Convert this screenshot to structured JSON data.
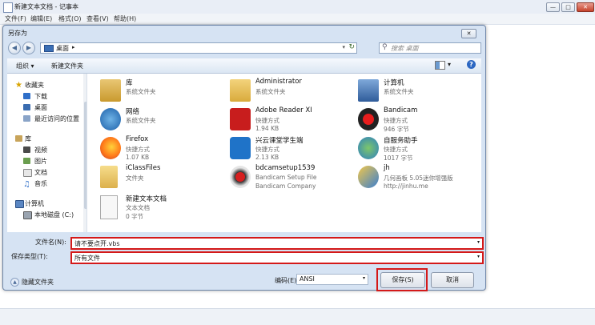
{
  "notepad": {
    "title": "新建文本文档 - 记事本",
    "menu": [
      "文件(F)",
      "编辑(E)",
      "格式(O)",
      "查看(V)",
      "帮助(H)"
    ],
    "window_buttons": [
      "—",
      "□",
      "✕"
    ]
  },
  "dialog": {
    "title": "另存为",
    "close": "✕",
    "nav_back": "◀",
    "nav_forward": "▶",
    "breadcrumb": "桌面",
    "breadcrumb_arrow": "▸",
    "address_dropdown": "▾",
    "refresh_icon": "↻",
    "search_placeholder": "搜索 桌面",
    "search_icon": "⚲",
    "toolbar": {
      "organize": "组织 ▾",
      "new_folder": "新建文件夹",
      "view_menu": "▾",
      "help": "?"
    },
    "nav_pane": {
      "favorites": "收藏夹",
      "favorites_items": [
        "下载",
        "桌面",
        "最近访问的位置"
      ],
      "libraries": "库",
      "library_items": [
        "视频",
        "图片",
        "文档",
        "音乐"
      ],
      "computer": "计算机",
      "computer_items": [
        "本地磁盘 (C:)"
      ]
    },
    "files": [
      {
        "name": "库",
        "l1": "系统文件夹",
        "l2": "",
        "icon": "library-icon"
      },
      {
        "name": "Administrator",
        "l1": "系统文件夹",
        "l2": "",
        "icon": "user-folder-icon"
      },
      {
        "name": "计算机",
        "l1": "系统文件夹",
        "l2": "",
        "icon": "computer-icon"
      },
      {
        "name": "网络",
        "l1": "系统文件夹",
        "l2": "",
        "icon": "network-icon"
      },
      {
        "name": "Adobe Reader XI",
        "l1": "快捷方式",
        "l2": "1.94 KB",
        "icon": "adobe-reader-icon"
      },
      {
        "name": "Bandicam",
        "l1": "快捷方式",
        "l2": "946 字节",
        "icon": "bandicam-icon"
      },
      {
        "name": "Firefox",
        "l1": "快捷方式",
        "l2": "1.07 KB",
        "icon": "firefox-icon"
      },
      {
        "name": "兴云课堂学生端",
        "l1": "快捷方式",
        "l2": "2.13 KB",
        "icon": "graduation-cap-icon"
      },
      {
        "name": "自服务助手",
        "l1": "快捷方式",
        "l2": "1017 字节",
        "icon": "service-assistant-icon"
      },
      {
        "name": "iClassFiles",
        "l1": "文件夹",
        "l2": "",
        "icon": "folder-icon"
      },
      {
        "name": "bdcamsetup1539",
        "l1": "Bandicam Setup File",
        "l2": "Bandicam Company",
        "icon": "installer-icon"
      },
      {
        "name": "jh",
        "l1": "几何画板 5.05迷你增强版",
        "l2": "http://jinhu.me",
        "icon": "geometry-icon"
      },
      {
        "name": "新建文本文档",
        "l1": "文本文档",
        "l2": "0 字节",
        "icon": "text-file-icon"
      }
    ],
    "filename_label": "文件名(N):",
    "filename_value": "请不要点开.vbs",
    "filetype_label": "保存类型(T):",
    "filetype_value": "所有文件",
    "combo_arrow": "▾",
    "hide_folders": "隐藏文件夹",
    "hide_icon": "▲",
    "encoding_label": "编码(E):",
    "encoding_value": "ANSI",
    "save_button": "保存(S)",
    "cancel_button": "取消"
  },
  "colors": {
    "highlight_red": "#d41919",
    "dialog_frame": "#d6e3f3",
    "accent_blue": "#2c67c2"
  }
}
